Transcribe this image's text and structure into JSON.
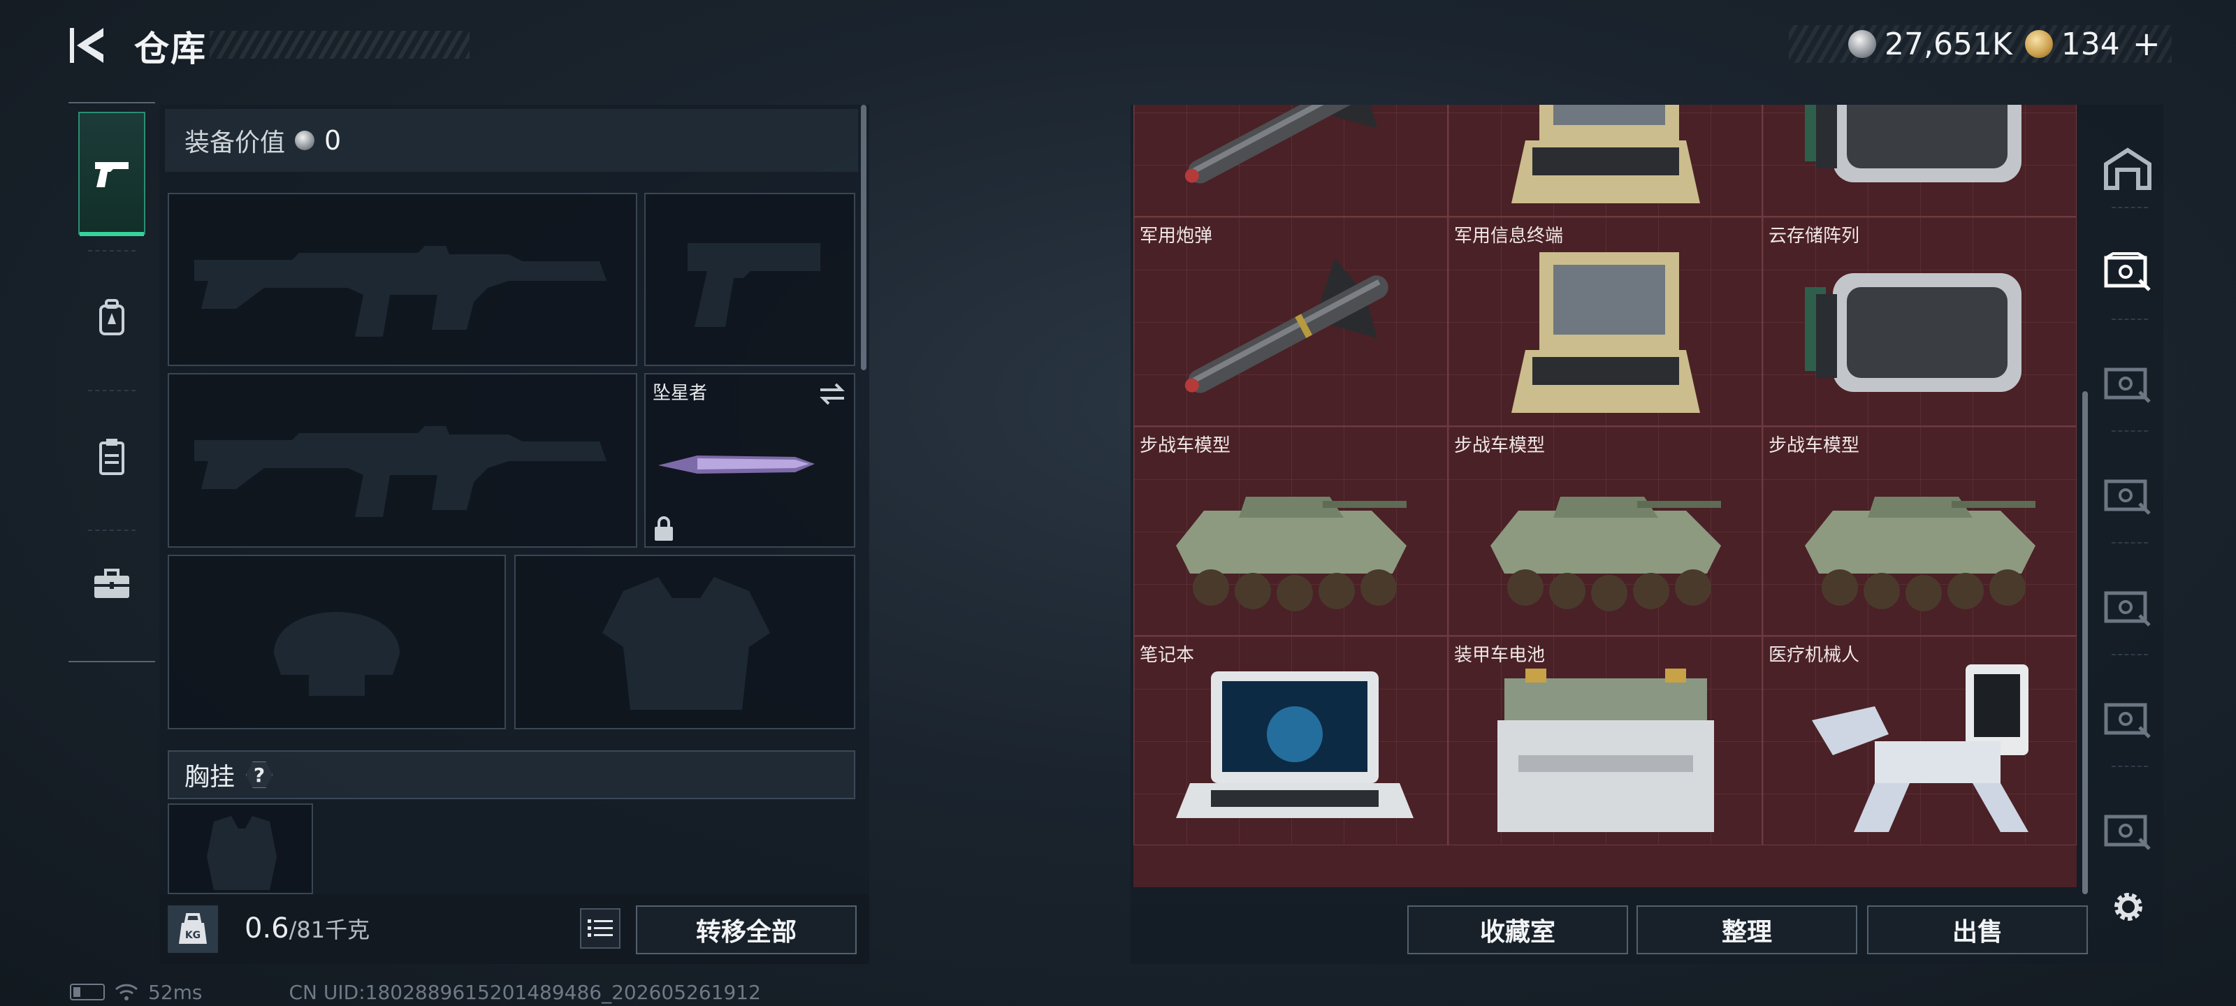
{
  "header": {
    "title": "仓库",
    "currency_silver": "27,651K",
    "currency_gold": "134",
    "plus": "+"
  },
  "left_tabs": [
    {
      "icon": "pistol-icon",
      "active": true
    },
    {
      "icon": "backpack-icon",
      "active": false
    },
    {
      "icon": "clipboard-icon",
      "active": false
    },
    {
      "icon": "briefcase-icon",
      "active": false
    }
  ],
  "equipment": {
    "value_label": "装备价值",
    "value": "0",
    "melee_name": "坠星者",
    "chest_label": "胸挂",
    "help": "?"
  },
  "weight": {
    "icon_text": "KG",
    "current": "0.6",
    "capacity": "/81千克"
  },
  "buttons": {
    "transfer_all": "转移全部",
    "collection": "收藏室",
    "organize": "整理",
    "sell": "出售"
  },
  "storage": {
    "rows": [
      [
        "",
        "",
        ""
      ],
      [
        "军用炮弹",
        "军用信息终端",
        "云存储阵列"
      ],
      [
        "步战车模型",
        "步战车模型",
        "步战车模型"
      ],
      [
        "笔记本",
        "装甲车电池",
        "医疗机械人"
      ]
    ]
  },
  "status_bar": {
    "ping": "52ms",
    "uid": "CN UID:1802889615201489486_202605261912"
  },
  "colors": {
    "accent": "#35d49c",
    "storage_bg": "#4a2126",
    "panel_bg": "#141c25"
  }
}
